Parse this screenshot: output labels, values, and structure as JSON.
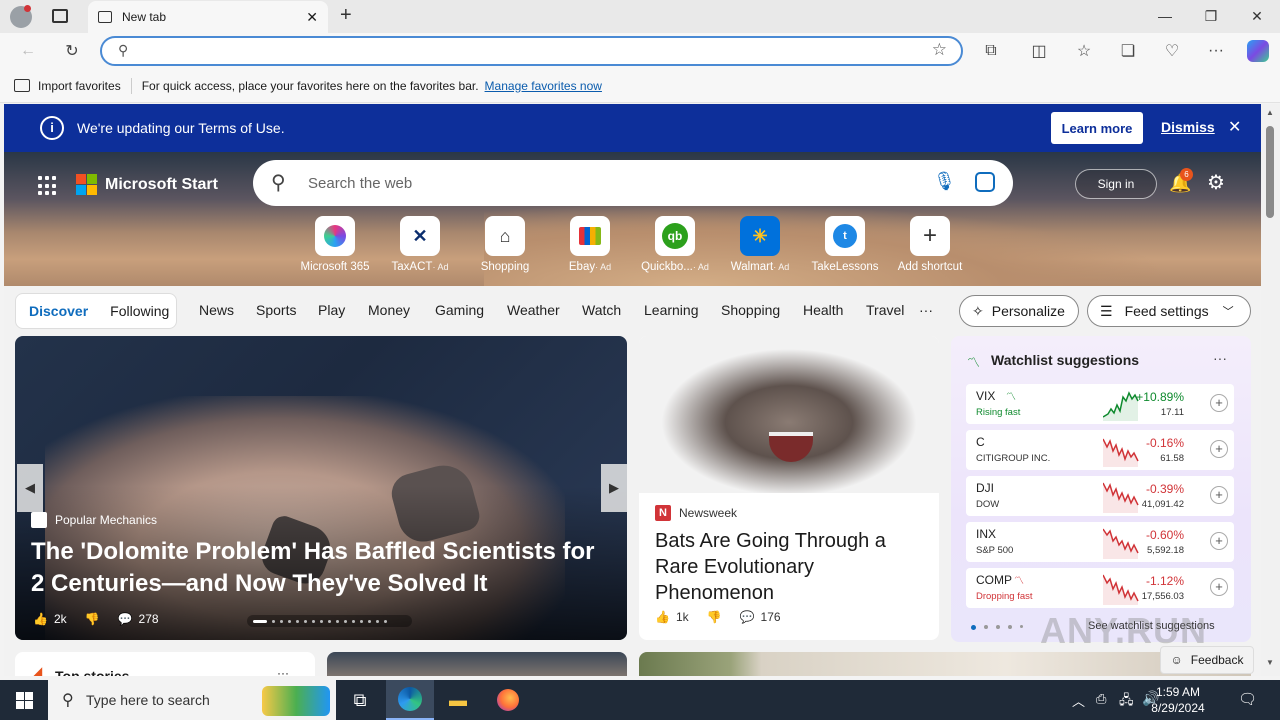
{
  "browser": {
    "tab_title": "New tab",
    "address_value": "",
    "favorites_bar": {
      "import_label": "Import favorites",
      "message": "For quick access, place your favorites here on the favorites bar.",
      "manage_link": "Manage favorites now"
    }
  },
  "banner": {
    "message": "We're updating our Terms of Use.",
    "learn_more": "Learn more",
    "dismiss": "Dismiss"
  },
  "header": {
    "brand": "Microsoft Start",
    "search_placeholder": "Search the web",
    "sign_in": "Sign in",
    "notification_count": "6"
  },
  "shortcuts": [
    {
      "label": "Microsoft 365",
      "ad": ""
    },
    {
      "label": "TaxACT",
      "ad": "· Ad"
    },
    {
      "label": "Shopping",
      "ad": ""
    },
    {
      "label": "Ebay",
      "ad": "· Ad"
    },
    {
      "label": "Quickbo...",
      "ad": "· Ad"
    },
    {
      "label": "Walmart",
      "ad": "· Ad"
    },
    {
      "label": "TakeLessons",
      "ad": ""
    },
    {
      "label": "Add shortcut",
      "ad": ""
    }
  ],
  "nav": {
    "discover": "Discover",
    "following": "Following",
    "items": [
      "News",
      "Sports",
      "Play",
      "Money",
      "Gaming",
      "Weather",
      "Watch",
      "Learning",
      "Shopping",
      "Health",
      "Travel"
    ],
    "more": "···",
    "personalize": "Personalize",
    "feed_settings": "Feed settings"
  },
  "main_story": {
    "source": "Popular Mechanics",
    "headline": "The 'Dolomite Problem' Has Baffled Scientists for 2 Centuries—and Now They've Solved It",
    "likes": "2k",
    "comments": "278"
  },
  "bat_story": {
    "source": "Newsweek",
    "headline": "Bats Are Going Through a Rare Evolutionary Phenomenon",
    "likes": "1k",
    "comments": "176"
  },
  "watchlist": {
    "title": "Watchlist suggestions",
    "see_more": "See watchlist suggestions",
    "stocks": [
      {
        "symbol": "VIX",
        "sub": "Rising fast",
        "change": "+10.89%",
        "price": "17.11",
        "direction": "up"
      },
      {
        "symbol": "C",
        "sub": "CITIGROUP INC.",
        "change": "-0.16%",
        "price": "61.58",
        "direction": "down"
      },
      {
        "symbol": "DJI",
        "sub": "DOW",
        "change": "-0.39%",
        "price": "41,091.42",
        "direction": "down"
      },
      {
        "symbol": "INX",
        "sub": "S&P 500",
        "change": "-0.60%",
        "price": "5,592.18",
        "direction": "down"
      },
      {
        "symbol": "COMP",
        "sub": "Dropping fast",
        "change": "-1.12%",
        "price": "17,556.03",
        "direction": "down"
      }
    ]
  },
  "below": {
    "top_stories": "Top stories"
  },
  "feedback": "Feedback",
  "watermark": "ANY.RUN",
  "taskbar": {
    "search_placeholder": "Type here to search",
    "time": "1:59 AM",
    "date": "8/29/2024"
  },
  "colors": {
    "banner": "#0d2f9a",
    "accent": "#0f6cbd",
    "positive": "#0f8a2e",
    "negative": "#d13438"
  }
}
